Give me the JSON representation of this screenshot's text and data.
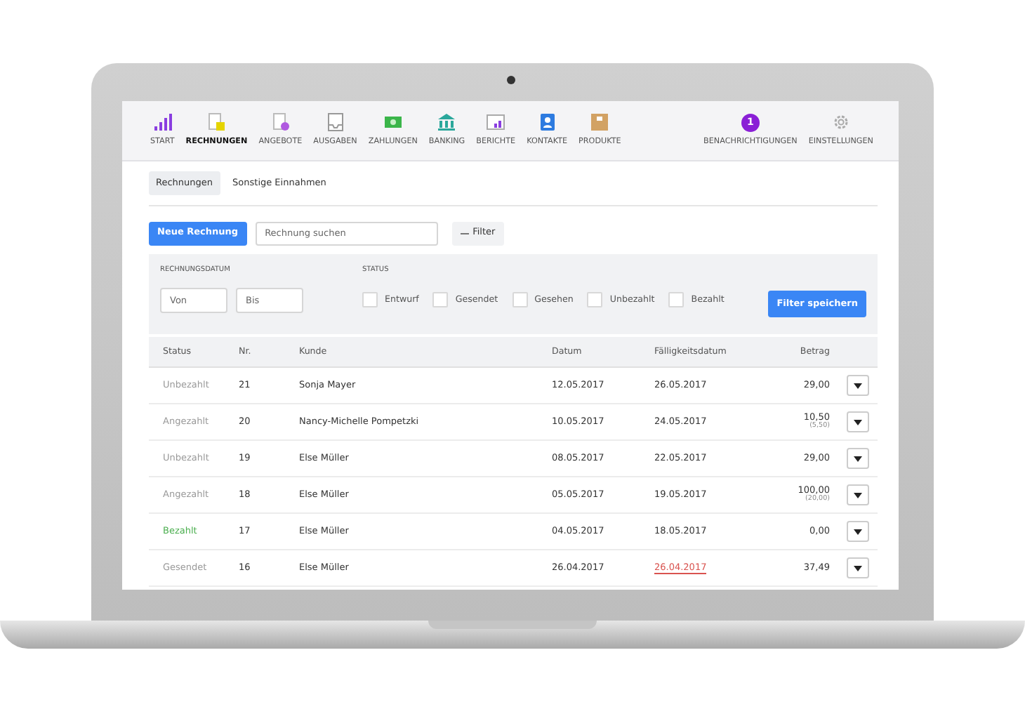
{
  "nav": [
    {
      "label": "START",
      "selected": false
    },
    {
      "label": "RECHNUNGEN",
      "selected": true
    },
    {
      "label": "ANGEBOTE",
      "selected": false
    },
    {
      "label": "AUSGABEN",
      "selected": false
    },
    {
      "label": "ZAHLUNGEN",
      "selected": false
    },
    {
      "label": "BANKING",
      "selected": false
    },
    {
      "label": "BERICHTE",
      "selected": false
    },
    {
      "label": "KONTAKTE",
      "selected": false
    },
    {
      "label": "PRODUKTE",
      "selected": false
    }
  ],
  "nav_right": {
    "notifications": {
      "label": "BENACHRICHTIGUNGEN",
      "count": "1"
    },
    "settings": {
      "label": "EINSTELLUNGEN"
    }
  },
  "subtabs": [
    {
      "label": "Rechnungen",
      "selected": true
    },
    {
      "label": "Sonstige Einnahmen",
      "selected": false
    }
  ],
  "toolbar": {
    "new_button": "Neue Rechnung",
    "search": {
      "placeholder": "Rechnung suchen"
    },
    "filter_button": "Filter"
  },
  "filter": {
    "date_label": "RECHNUNGSDATUM",
    "from": {
      "placeholder": "Von"
    },
    "to": {
      "placeholder": "Bis"
    },
    "status_label": "STATUS",
    "statuses": [
      {
        "label": "Entwurf",
        "checked": false
      },
      {
        "label": "Gesendet",
        "checked": false
      },
      {
        "label": "Gesehen",
        "checked": false
      },
      {
        "label": "Unbezahlt",
        "checked": false
      },
      {
        "label": "Bezahlt",
        "checked": false
      }
    ],
    "save_button": "Filter speichern"
  },
  "table": {
    "columns": [
      "Status",
      "Nr.",
      "Kunde",
      "Datum",
      "Fälligkeitsdatum",
      "Betrag"
    ],
    "rows": [
      {
        "status": "Unbezahlt",
        "color": "#9a9a9a",
        "nr": "21",
        "kunde": "Sonja Mayer",
        "datum": "12.05.2017",
        "faellig": "26.05.2017",
        "overdue": false,
        "betrag": "29,00"
      },
      {
        "status": "Angezahlt",
        "color": "#9a9a9a",
        "nr": "20",
        "kunde": "Nancy-Michelle Pompetzki",
        "datum": "10.05.2017",
        "faellig": "24.05.2017",
        "overdue": false,
        "betrag": "10,50",
        "paid": "(5,50)"
      },
      {
        "status": "Unbezahlt",
        "color": "#9a9a9a",
        "nr": "19",
        "kunde": "Else Müller",
        "datum": "08.05.2017",
        "faellig": "22.05.2017",
        "overdue": false,
        "betrag": "29,00"
      },
      {
        "status": "Angezahlt",
        "color": "#9a9a9a",
        "nr": "18",
        "kunde": "Else Müller",
        "datum": "05.05.2017",
        "faellig": "19.05.2017",
        "overdue": false,
        "betrag": "100,00",
        "paid": "(20,00)"
      },
      {
        "status": "Bezahlt",
        "color": "#4caf50",
        "nr": "17",
        "kunde": "Else Müller",
        "datum": "04.05.2017",
        "faellig": "18.05.2017",
        "overdue": false,
        "betrag": "0,00"
      },
      {
        "status": "Gesendet",
        "color": "#9a9a9a",
        "nr": "16",
        "kunde": "Else Müller",
        "datum": "26.04.2017",
        "faellig": "26.04.2017",
        "overdue": true,
        "betrag": "37,49"
      }
    ]
  }
}
